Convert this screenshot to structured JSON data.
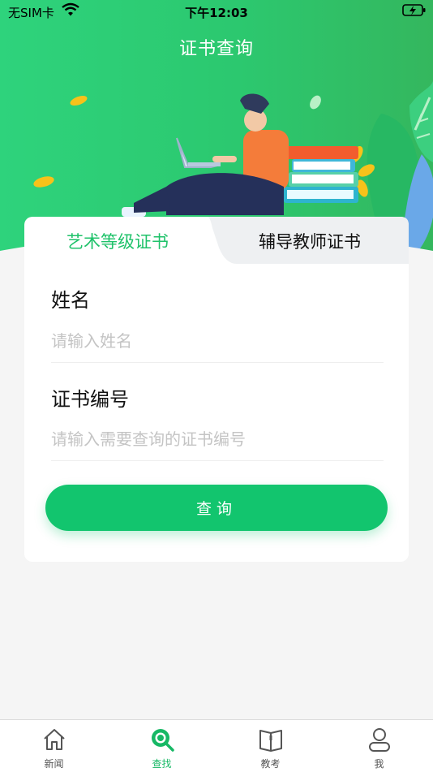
{
  "status_bar": {
    "carrier": "无SIM卡",
    "time": "下午12:03"
  },
  "header": {
    "title": "证书查询"
  },
  "tabs": [
    {
      "label": "艺术等级证书",
      "active": true
    },
    {
      "label": "辅导教师证书",
      "active": false
    }
  ],
  "form": {
    "name_label": "姓名",
    "name_placeholder": "请输入姓名",
    "cert_label": "证书编号",
    "cert_placeholder": "请输入需要查询的证书编号",
    "submit_label": "查询"
  },
  "tabbar": {
    "items": [
      {
        "label": "新闻",
        "icon": "home-icon",
        "active": false
      },
      {
        "label": "查找",
        "icon": "search-icon",
        "active": true
      },
      {
        "label": "教考",
        "icon": "book-icon",
        "active": false
      },
      {
        "label": "我",
        "icon": "user-icon",
        "active": false
      }
    ]
  },
  "colors": {
    "accent": "#12c56e",
    "header_green": "#2ed37c",
    "active_tab_text": "#1fc26a"
  }
}
